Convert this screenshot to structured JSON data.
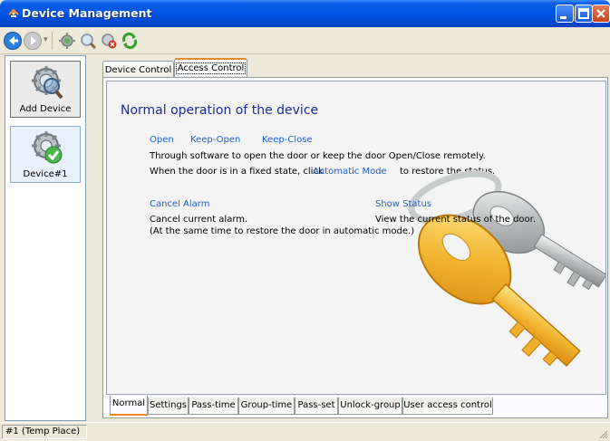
{
  "window": {
    "title": "Device Management",
    "icon": "app-logo-icon",
    "controls": [
      "minimize-icon",
      "maximize-icon",
      "close-icon"
    ]
  },
  "toolbar": {
    "icons": [
      "back-arrow-icon",
      "forward-arrow-icon",
      "add-device-icon",
      "search-device-icon",
      "remove-device-icon",
      "refresh-icon"
    ]
  },
  "devices": {
    "items": [
      {
        "label": "Add Device",
        "icon": "magnifier-search-icon"
      },
      {
        "label": "Device#1",
        "icon": "device-connected-icon"
      }
    ]
  },
  "tabs_top": [
    {
      "label": "Device Control"
    },
    {
      "label": "Access Control"
    }
  ],
  "content": {
    "heading": "Normal operation of the device",
    "open_link": "Open",
    "keep_open_link": "Keep-Open",
    "keep_close_link": "Keep-Close",
    "remote_text": "Through software to open the door or keep the door Open/Close remotely.",
    "fixed_state_text": "When the door is in a fixed state, click",
    "automatic_mode_link": "Automatic Mode",
    "restore_text": "to restore the status.",
    "cancel_alarm_link": "Cancel Alarm",
    "cancel_alarm_desc1": "Cancel current alarm.",
    "cancel_alarm_desc2": "(At the same time to restore the door in automatic mode.)",
    "show_status_link": "Show Status",
    "show_status_desc": "View the current status of the door."
  },
  "tabs_bottom": [
    {
      "label": "Normal"
    },
    {
      "label": "Settings"
    },
    {
      "label": "Pass-time"
    },
    {
      "label": "Group-time"
    },
    {
      "label": "Pass-set"
    },
    {
      "label": "Unlock-group"
    },
    {
      "label": "User access control"
    }
  ],
  "status": {
    "place": "#1 (Temp Place)"
  },
  "colors": {
    "titlebar": "#0054e3",
    "link": "#1b60d6",
    "heading": "#1c2aa0",
    "active_tab_accent": "#e68b2c",
    "key_gold": "#f2b630",
    "key_silver": "#b9bcbd"
  }
}
